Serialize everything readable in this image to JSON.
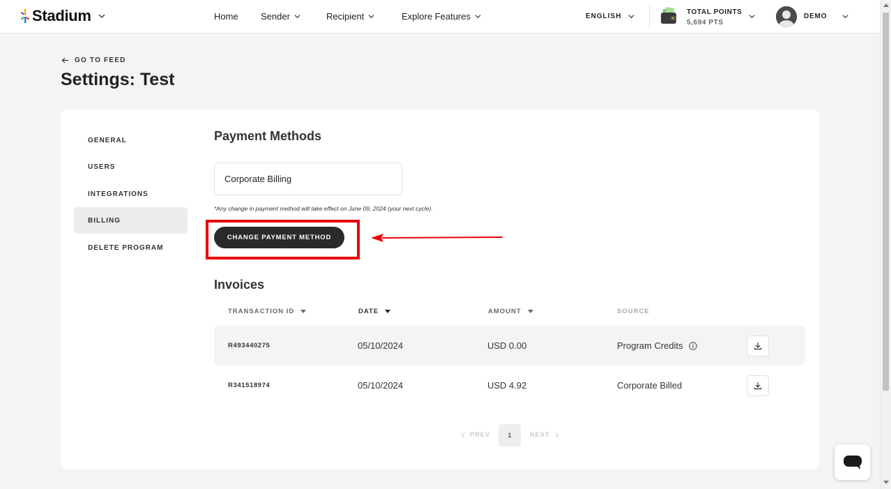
{
  "header": {
    "brand": "Stadium",
    "nav": [
      "Home",
      "Sender",
      "Recipient",
      "Explore Features"
    ],
    "language": "ENGLISH",
    "points_label": "TOTAL POINTS",
    "points_value": "5,694 PTS",
    "user_name": "DEMO"
  },
  "page": {
    "back_label": "GO TO FEED",
    "title": "Settings: Test"
  },
  "sidebar": {
    "items": [
      "GENERAL",
      "USERS",
      "INTEGRATIONS",
      "BILLING",
      "DELETE PROGRAM"
    ],
    "active": "BILLING"
  },
  "payment": {
    "title": "Payment Methods",
    "method": "Corporate Billing",
    "note": "*Any change in payment method will take effect on June 09, 2024 (your next cycle).",
    "change_button": "CHANGE PAYMENT METHOD"
  },
  "invoices": {
    "title": "Invoices",
    "columns": [
      "TRANSACTION ID",
      "DATE",
      "AMOUNT",
      "SOURCE"
    ],
    "rows": [
      {
        "id": "R493440275",
        "date": "05/10/2024",
        "amount": "USD 0.00",
        "source": "Program Credits"
      },
      {
        "id": "R341518974",
        "date": "05/10/2024",
        "amount": "USD 4.92",
        "source": "Corporate Billed"
      }
    ]
  },
  "pagination": {
    "prev": "PREV",
    "page": "1",
    "next": "NEXT"
  },
  "colors": {
    "highlight": "#e8000c",
    "button": "#2a2a2a"
  }
}
